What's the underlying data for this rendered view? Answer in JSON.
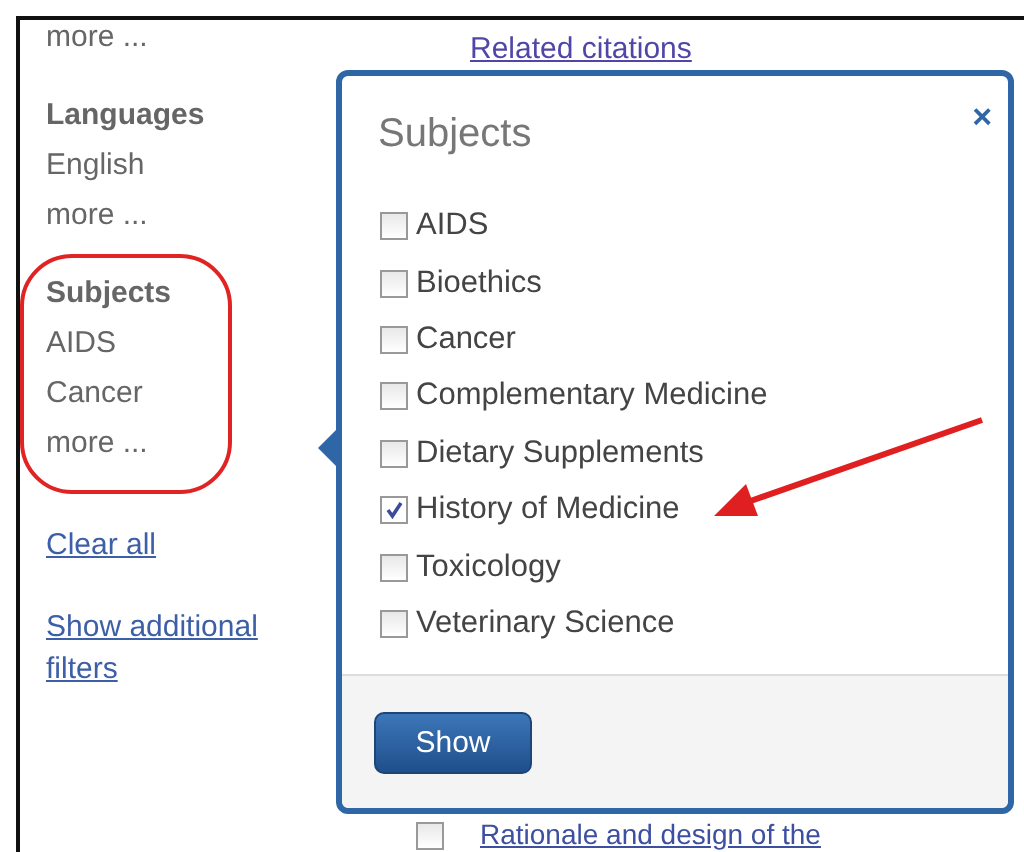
{
  "sidebar": {
    "top_link": "more ...",
    "groups": [
      {
        "heading": "Languages",
        "items": [
          "English"
        ],
        "more": "more ..."
      },
      {
        "heading": "Subjects",
        "items": [
          "AIDS",
          "Cancer"
        ],
        "more": "more ...",
        "highlighted": true
      }
    ],
    "clear": "Clear all",
    "additional": "Show additional filters"
  },
  "results": {
    "related": "Related citations",
    "next_title": "Rationale and design of the",
    "next_checked": false
  },
  "popup": {
    "title": "Subjects",
    "close": "×",
    "options": [
      {
        "label": "AIDS",
        "checked": false
      },
      {
        "label": "Bioethics",
        "checked": false
      },
      {
        "label": "Cancer",
        "checked": false
      },
      {
        "label": "Complementary Medicine",
        "checked": false
      },
      {
        "label": "Dietary Supplements",
        "checked": false
      },
      {
        "label": "History of Medicine",
        "checked": true,
        "annotated": true
      },
      {
        "label": "Toxicology",
        "checked": false
      },
      {
        "label": "Veterinary Science",
        "checked": false
      }
    ],
    "button": "Show"
  }
}
